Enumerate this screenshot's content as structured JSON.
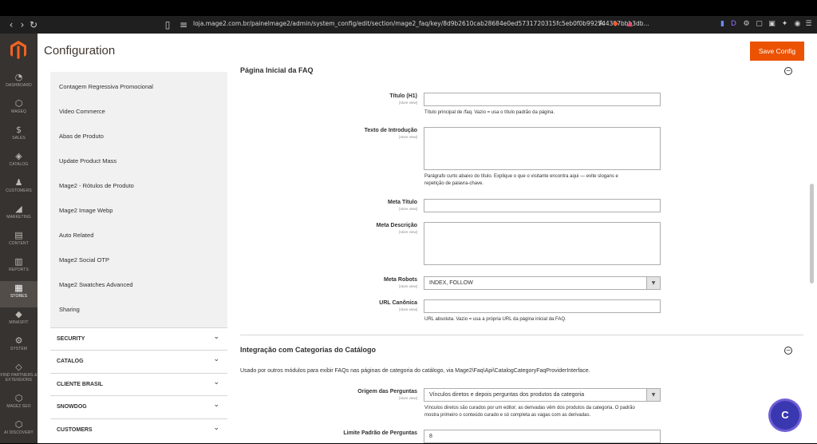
{
  "browser": {
    "url": "loja.mage2.com.br/painelmage2/admin/system_config/edit/section/mage2_faq/key/8d9b2610cab28684e0ed5731720315fc5eb0f0b992544397bbb3db...",
    "icons": [
      "back-icon",
      "forward-icon",
      "reload-icon",
      "bookmark-icon",
      "site-settings-icon",
      "translate-icon",
      "brave-shield-icon",
      "brave-rewards-icon"
    ]
  },
  "admin_nav": {
    "items": [
      {
        "label": "DASHBOARD",
        "icon": "dashboard-icon",
        "glyph": "◔"
      },
      {
        "label": "MAGEQ",
        "icon": "hexagon-icon",
        "glyph": "⬡"
      },
      {
        "label": "SALES",
        "icon": "dollar-icon",
        "glyph": "$"
      },
      {
        "label": "CATALOG",
        "icon": "cube-icon",
        "glyph": "◈"
      },
      {
        "label": "CUSTOMERS",
        "icon": "person-icon",
        "glyph": "♟"
      },
      {
        "label": "MARKETING",
        "icon": "megaphone-icon",
        "glyph": "◢"
      },
      {
        "label": "CONTENT",
        "icon": "content-icon",
        "glyph": "▤"
      },
      {
        "label": "REPORTS",
        "icon": "reports-icon",
        "glyph": "▥"
      },
      {
        "label": "STORES",
        "icon": "store-icon",
        "glyph": "▦"
      },
      {
        "label": "MINASFIT",
        "icon": "diamond-icon",
        "glyph": "◆"
      },
      {
        "label": "SYSTEM",
        "icon": "gear-icon",
        "glyph": "⚙"
      },
      {
        "label": "FIND PARTNERS & EXTENSIONS",
        "icon": "extensions-icon",
        "glyph": "◇"
      },
      {
        "label": "MAGE2 SEO",
        "icon": "seo-icon",
        "glyph": "⬡"
      },
      {
        "label": "AI DISCOVERY",
        "icon": "ai-icon",
        "glyph": "⬡"
      }
    ]
  },
  "page": {
    "title": "Configuration",
    "save_label": "Save Config"
  },
  "left_panel": {
    "items": [
      "Contagem Regressiva Promocional",
      "Video Commerce",
      "Abas de Produto",
      "Update Product Mass",
      "Mage2 - Rótulos de Produto",
      "Mage2 Image Webp",
      "Auto Related",
      "Mage2 Social OTP",
      "Mage2 Swatches Advanced",
      "Sharing"
    ],
    "sections": [
      "SECURITY",
      "CATALOG",
      "CLIENTE BRASIL",
      "SNOWDOG",
      "CUSTOMERS"
    ]
  },
  "group1": {
    "title": "Página Inicial da FAQ",
    "fields": {
      "title_label": "Título (H1)",
      "title_scope": "[store view]",
      "title_note": "Título principal de /faq. Vazio = usa o título padrão da página.",
      "intro_label": "Texto de Introdução",
      "intro_scope": "[store view]",
      "intro_note_1": "Parágrafo curto abaixo do título. Explique o que o visitante encontra aqui — evite slogans e",
      "intro_note_2": "repetição de palavra-chave.",
      "meta_title_label": "Meta Título",
      "meta_title_scope": "[store view]",
      "meta_desc_label": "Meta Descrição",
      "meta_desc_scope": "[store view]",
      "robots_label": "Meta Robots",
      "robots_scope": "[store view]",
      "robots_value": "INDEX, FOLLOW",
      "canonical_label": "URL Canônica",
      "canonical_scope": "[store view]",
      "canonical_note": "URL absoluta. Vazio = usa a própria URL da página inicial da FAQ."
    }
  },
  "group2": {
    "title": "Integração com Categorias do Catálogo",
    "description": "Usado por outros módulos para exibir FAQs nas páginas de categoria do catálogo, via Mage2\\Faq\\Api\\CatalogCategoryFaqProviderInterface.",
    "origin_label": "Origem das Perguntas",
    "origin_scope": "[store view]",
    "origin_value": "Vínculos diretos e depois perguntas dos produtos da categoria",
    "origin_note_1": "Vínculos diretos são curados por um editor; as derivadas vêm dos produtos da categoria. O padrão",
    "origin_note_2": "mostra primeiro o conteúdo curado e só completa as vagas com as derivadas.",
    "limit_label": "Limite Padrão de Perguntas",
    "limit_value": "8"
  },
  "chat": {
    "letter": "C"
  },
  "colors": {
    "accent": "#eb5202",
    "nav_bg": "#373330",
    "chat": "#3a38b0"
  }
}
